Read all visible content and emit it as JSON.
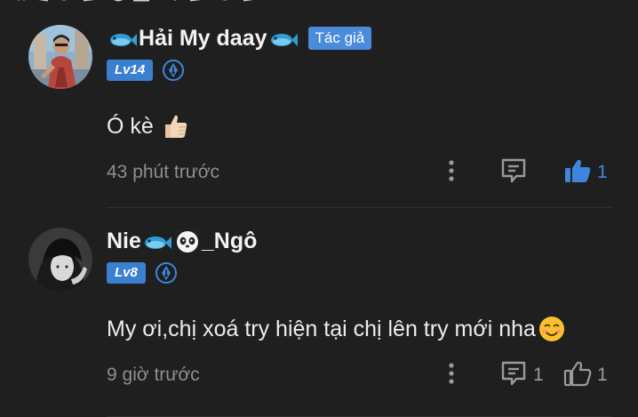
{
  "comments": [
    {
      "username_parts": [
        "Hải My daay"
      ],
      "author_badge": "Tác giả",
      "level": "Lv14",
      "text": "Ó kè",
      "timestamp": "43 phút trước",
      "reply_count": "",
      "like_count": "1",
      "liked": true
    },
    {
      "username_parts": [
        "Nie",
        "_Ngô"
      ],
      "level": "Lv8",
      "text": "My ơi,chị xoá try hiện tại chị lên try mới nha",
      "timestamp": "9 giờ trước",
      "reply_count": "1",
      "like_count": "1",
      "liked": false
    }
  ],
  "colors": {
    "background": "#1f1f1f",
    "accent": "#3d86e0",
    "author_badge": "#4a8cdb",
    "level_badge": "#3a7fd0",
    "muted_text": "#8e8e8e"
  },
  "icons": [
    "fish-icon",
    "panda-icon",
    "pen-icon",
    "thumbs-up-emoji",
    "smile-emoji",
    "more-vertical-icon",
    "reply-comment-icon",
    "like-icon"
  ]
}
